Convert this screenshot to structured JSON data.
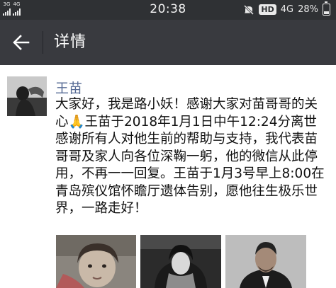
{
  "status_bar": {
    "network_1": "3G",
    "network_2": "4G",
    "time": "20:38",
    "hd": "HD",
    "network_type": "4G",
    "battery": "28%",
    "battery_level": 0.28,
    "icons": [
      "signal-icon",
      "mute-icon",
      "battery-icon"
    ]
  },
  "header": {
    "back_icon": "back-arrow-icon",
    "title": "详情"
  },
  "post": {
    "author": "王苗",
    "lines": [
      "大家好，我是路小妖！感谢大家对苗哥哥的关",
      "心🙏王苗于2018年1月1日中午12:24分离世",
      "感谢所有人对他生前的帮助与支持，我代表苗",
      "哥哥及家人向各位深鞠一躬，他的微信从此停",
      "用，不再一一回复。王苗于1月3号早上8:00在",
      "青岛殡仪馆怀瞻厅遗体告别，愿他往生极乐世",
      "界，一路走好！"
    ]
  },
  "colors": {
    "status_bar_bg": "#2f3134",
    "title_bar_bg": "#393a3f",
    "author_name": "#576b95",
    "text": "#111111"
  }
}
